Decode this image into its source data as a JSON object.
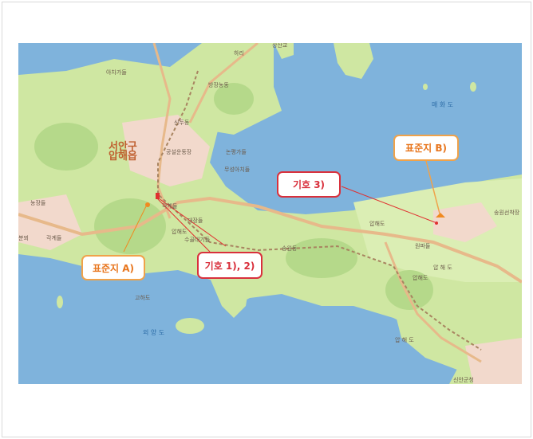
{
  "map": {
    "callouts": {
      "standard_a": "표준지 A)",
      "standard_b": "표준지 B)",
      "symbol_12": "기호 1), 2)",
      "symbol_3": "기호 3)"
    },
    "place_labels": {
      "district_line1": "서안구",
      "district_line2": "압해읍",
      "label_top_right": "장산교",
      "label_a": "하리",
      "label_b": "아차가들",
      "label_c": "방장농동",
      "label_d": "신두동",
      "label_e": "공설운동장",
      "label_f": "논평가들",
      "label_g": "무성아치들",
      "label_h": "압해도",
      "label_i": "분뫼",
      "label_j": "각계들",
      "label_k": "압해도",
      "label_l": "각계들",
      "label_m": "수골대기들",
      "label_n": "대장들",
      "label_o": "송원동",
      "label_p": "원파들",
      "label_q": "압해도",
      "label_r": "매 화 도",
      "label_s": "압 해 도",
      "label_t": "외 양 도",
      "label_u": "고하도",
      "label_v": "송원선착장",
      "label_w": "신안군청",
      "label_x": "농장들"
    },
    "colors": {
      "water": "#7fb3dc",
      "land": "#cfe7a2",
      "forest": "#b5d98a",
      "urban": "#f2d9cc",
      "road": "#e7b98a",
      "orange_accent": "#f0a24a",
      "red_accent": "#d9303c"
    }
  }
}
